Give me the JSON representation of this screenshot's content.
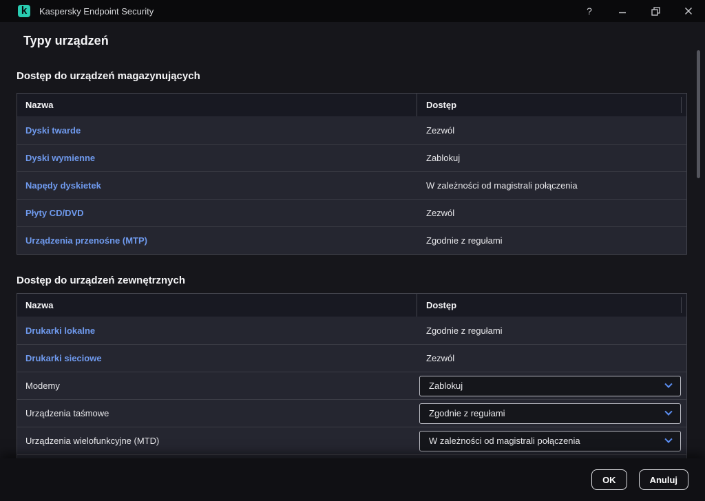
{
  "window": {
    "app_title": "Kaspersky Endpoint Security",
    "logo_letter": "k",
    "controls": {
      "help": "?"
    }
  },
  "page": {
    "title": "Typy urządzeń"
  },
  "sections": [
    {
      "heading": "Dostęp do urządzeń magazynujących",
      "columns": [
        "Nazwa",
        "Dostęp"
      ],
      "rows": [
        {
          "name": "Dyski twarde",
          "access": "Zezwól",
          "link": true,
          "dropdown": false
        },
        {
          "name": "Dyski wymienne",
          "access": "Zablokuj",
          "link": true,
          "dropdown": false
        },
        {
          "name": "Napędy dyskietek",
          "access": "W zależności od magistrali połączenia",
          "link": true,
          "dropdown": false
        },
        {
          "name": "Płyty CD/DVD",
          "access": "Zezwól",
          "link": true,
          "dropdown": false
        },
        {
          "name": "Urządzenia przenośne (MTP)",
          "access": "Zgodnie z regułami",
          "link": true,
          "dropdown": false
        }
      ],
      "partial_row": false
    },
    {
      "heading": "Dostęp do urządzeń zewnętrznych",
      "columns": [
        "Nazwa",
        "Dostęp"
      ],
      "rows": [
        {
          "name": "Drukarki lokalne",
          "access": "Zgodnie z regułami",
          "link": true,
          "dropdown": false
        },
        {
          "name": "Drukarki sieciowe",
          "access": "Zezwól",
          "link": true,
          "dropdown": false
        },
        {
          "name": "Modemy",
          "access": "Zablokuj",
          "link": false,
          "dropdown": true
        },
        {
          "name": "Urządzenia taśmowe",
          "access": "Zgodnie z regułami",
          "link": false,
          "dropdown": true
        },
        {
          "name": "Urządzenia wielofunkcyjne (MTD)",
          "access": "W zależności od magistrali połączenia",
          "link": false,
          "dropdown": true
        }
      ],
      "partial_row": true
    }
  ],
  "footer": {
    "ok_label": "OK",
    "cancel_label": "Anuluj"
  },
  "colors": {
    "brand_teal": "#29ccb1",
    "link_blue": "#6f9aee",
    "chevron_blue": "#5b8df0",
    "row_bg": "#252630",
    "table_header_bg": "#181922",
    "titlebar_bg": "#0a0a0c",
    "content_bg": "#16161b",
    "footer_bg": "#101014"
  }
}
